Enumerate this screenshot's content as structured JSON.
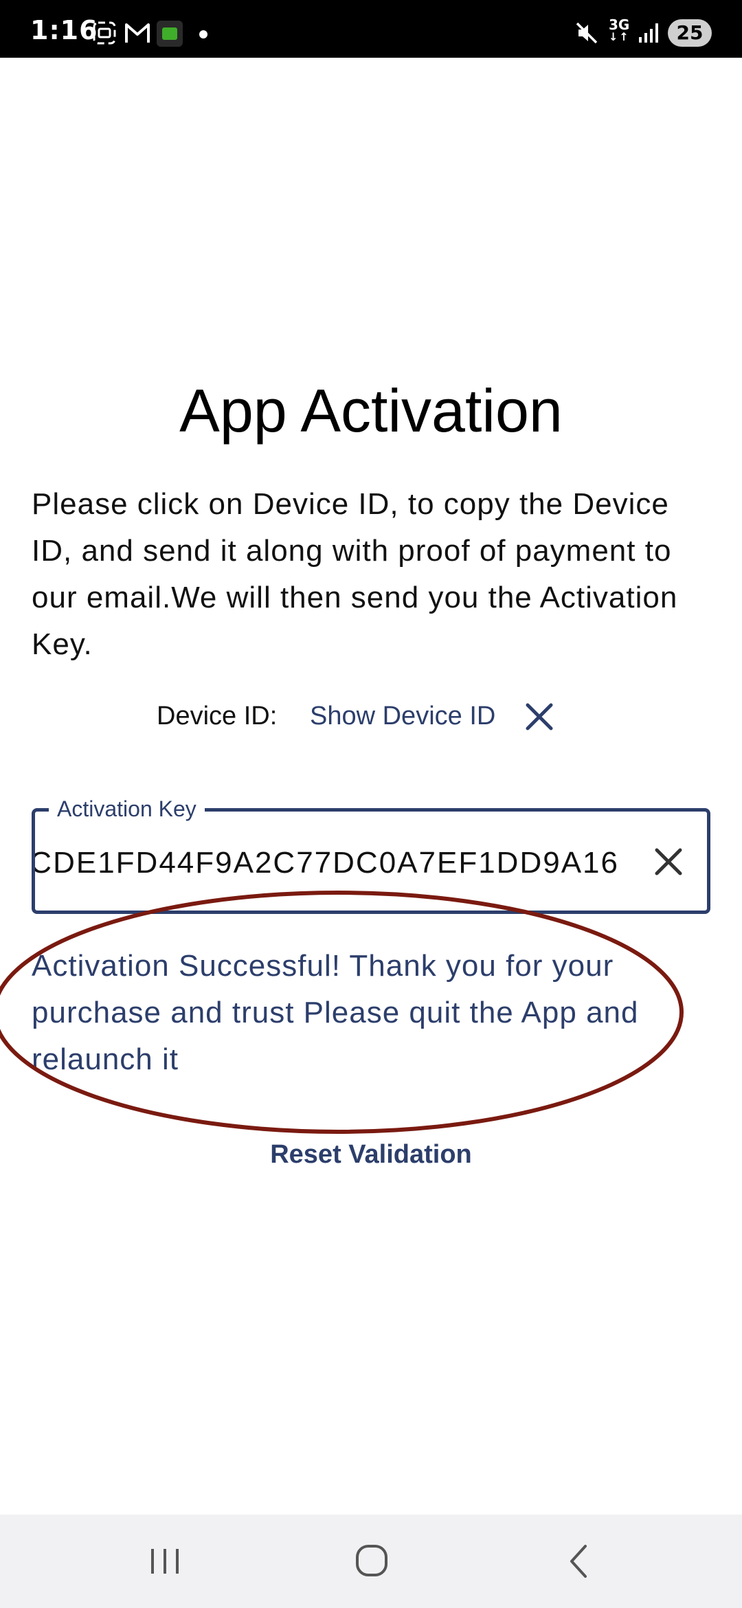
{
  "status_bar": {
    "time": "1:16",
    "battery": "25",
    "network": "3G",
    "icons": [
      "screenshot-icon",
      "gmail-icon",
      "app-notification-icon",
      "dot-icon",
      "mute-icon",
      "network-3g-icon",
      "signal-icon",
      "battery-icon"
    ]
  },
  "page": {
    "title": "App Activation",
    "instructions": "Please click on Device ID, to copy the Device ID, and send it along with proof of payment to our email.We will then send you the Activation Key.",
    "device_id_label": "Device ID:",
    "device_id_link": "Show Device ID",
    "activation_key_label": "Activation Key",
    "activation_key_value": "CDE1FD44F9A2C77DC0A7EF1DD9A16",
    "success_message": "Activation Successful! Thank you for your purchase and trust Please quit the App and relaunch it",
    "reset_button": "Reset Validation"
  },
  "colors": {
    "accent": "#2c3e6b",
    "annotation_ellipse": "#7a1a10",
    "status_bar_bg": "#000000",
    "nav_bar_bg": "#f1f1f3"
  },
  "nav_bar": {
    "buttons": [
      "recent-apps-icon",
      "home-icon",
      "back-icon"
    ]
  }
}
